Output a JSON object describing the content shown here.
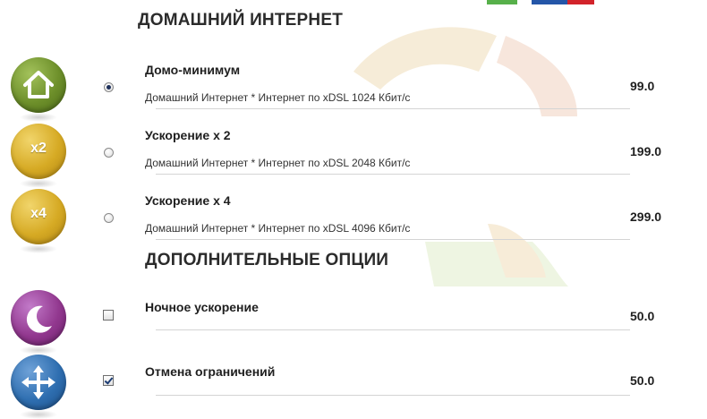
{
  "sections": {
    "home_internet_title": "ДОМАШНИЙ ИНТЕРНЕТ",
    "extra_options_title": "ДОПОЛНИТЕЛЬНЫЕ ОПЦИИ"
  },
  "plans": [
    {
      "name": "Домо-минимум",
      "description": "Домашний Интернет * Интернет по xDSL 1024 Кбит/с",
      "price": "99.0",
      "selected": true,
      "icon": "house-icon"
    },
    {
      "name": "Ускорение x 2",
      "description": "Домашний Интернет * Интернет по xDSL 2048 Кбит/с",
      "price": "199.0",
      "selected": false,
      "icon": "x2-icon",
      "icon_label": "x2"
    },
    {
      "name": "Ускорение x 4",
      "description": "Домашний Интернет * Интернет по xDSL 4096 Кбит/с",
      "price": "299.0",
      "selected": false,
      "icon": "x4-icon",
      "icon_label": "x4"
    }
  ],
  "options": [
    {
      "name": "Ночное ускорение",
      "price": "50.0",
      "checked": false,
      "icon": "moon-icon"
    },
    {
      "name": "Отмена ограничений",
      "price": "50.0",
      "checked": true,
      "icon": "arrows-icon"
    }
  ],
  "colors": {
    "green": "#6d8f2a",
    "gold": "#d6aa24",
    "purple": "#92388f",
    "blue": "#2e6eb0"
  }
}
